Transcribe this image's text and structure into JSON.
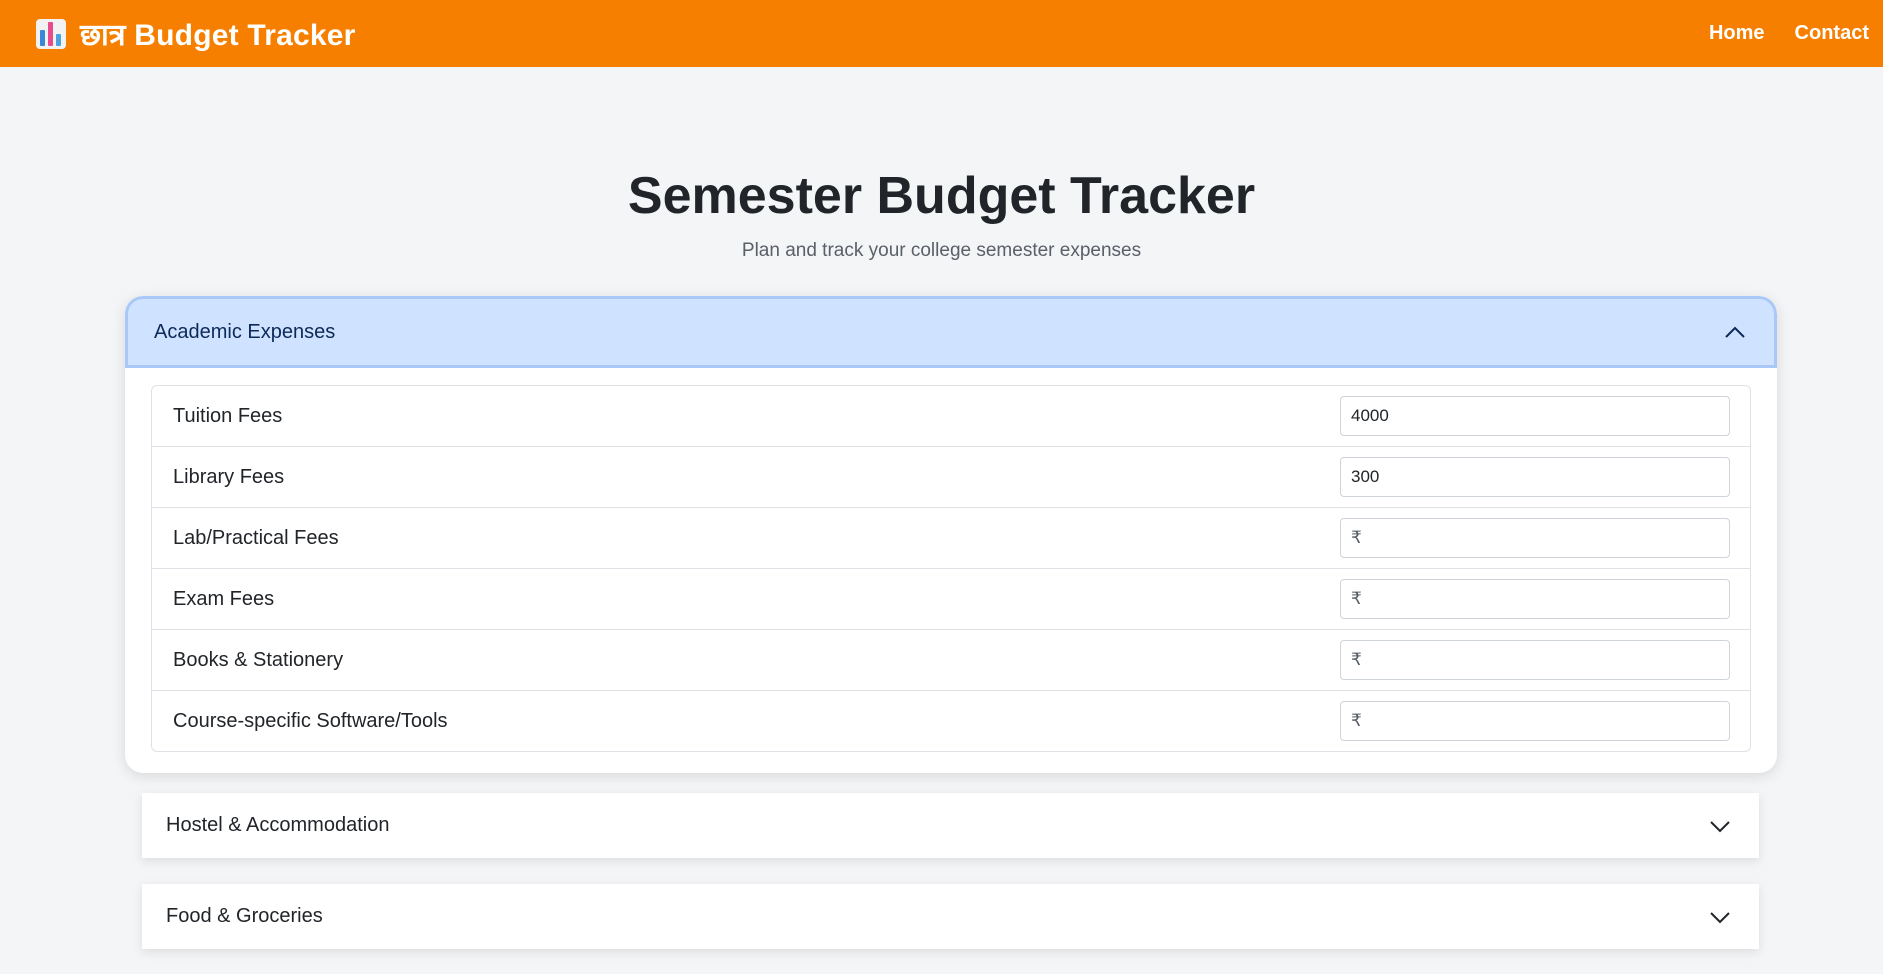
{
  "navbar": {
    "brand": "छात्र Budget Tracker",
    "brand_icon": "bar-chart-icon",
    "links": [
      "Home",
      "Contact"
    ],
    "color": "#f77f00"
  },
  "page": {
    "title": "Semester Budget Tracker",
    "subtitle": "Plan and track your college semester expenses"
  },
  "academic": {
    "label": "Academic Expenses",
    "expanded": true,
    "items": [
      {
        "label": "Tuition Fees",
        "value": "4000",
        "placeholder": "₹"
      },
      {
        "label": "Library Fees",
        "value": "300",
        "placeholder": "₹"
      },
      {
        "label": "Lab/Practical Fees",
        "value": "",
        "placeholder": "₹"
      },
      {
        "label": "Exam Fees",
        "value": "",
        "placeholder": "₹"
      },
      {
        "label": "Books & Stationery",
        "value": "",
        "placeholder": "₹"
      },
      {
        "label": "Course-specific Software/Tools",
        "value": "",
        "placeholder": "₹"
      }
    ]
  },
  "hostel": {
    "label": "Hostel & Accommodation",
    "expanded": false
  },
  "food": {
    "label": "Food & Groceries",
    "expanded": false
  },
  "colors": {
    "accent": "#f77f00",
    "open_header_bg": "#cfe2ff",
    "open_header_border": "#a9c8f7",
    "page_bg": "#f4f5f7"
  }
}
